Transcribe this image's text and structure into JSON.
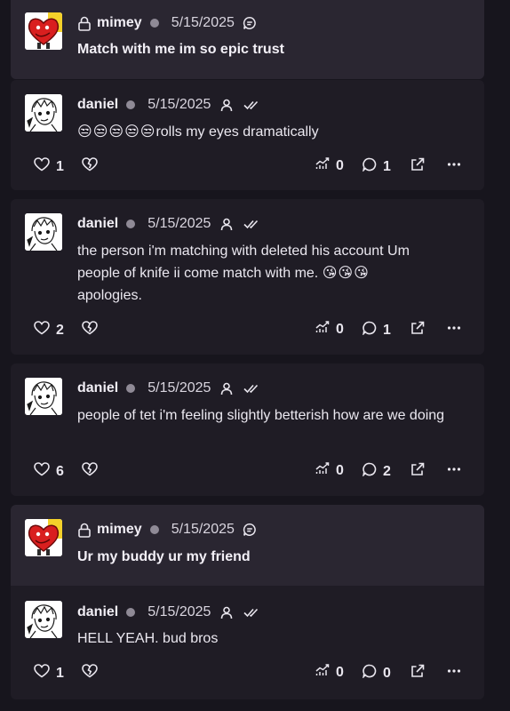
{
  "posts": [
    {
      "author": "mimey",
      "date": "5/15/2025",
      "text": "Match with me im so epic trust"
    },
    {
      "author": "daniel",
      "date": "5/15/2025",
      "emoji": [
        "😒",
        "😒",
        "😒",
        "😒",
        "😒"
      ],
      "text": "rolls my eyes dramatically",
      "likes": "1",
      "views": "0",
      "replies": "1"
    },
    {
      "author": "daniel",
      "date": "5/15/2025",
      "text_line1": "the person i'm matching with deleted his account Um",
      "text_line2": "people of knife ii come match with me.",
      "emoji": [
        "😘",
        "😘",
        "😘"
      ],
      "text_line3": "apologies.",
      "likes": "2",
      "views": "0",
      "replies": "1"
    },
    {
      "author": "daniel",
      "date": "5/15/2025",
      "text": "people of tet i'm feeling slightly betterish how are we doing",
      "likes": "6",
      "views": "0",
      "replies": "2"
    },
    {
      "author": "mimey",
      "date": "5/15/2025",
      "text": "Ur my buddy ur my friend"
    },
    {
      "author": "daniel",
      "date": "5/15/2025",
      "text": "HELL YEAH. bud bros",
      "likes": "1",
      "views": "0",
      "replies": "0"
    }
  ],
  "colors": {
    "page": "#17151d",
    "card": "#1f1c25",
    "quoted": "#2a2631",
    "status_dot": "#8f8a96"
  },
  "icons": [
    "lock-icon",
    "chat-bubble-icon",
    "person-icon",
    "double-check-icon",
    "heart-icon",
    "broken-heart-icon",
    "views-chart-icon",
    "comment-icon",
    "share-icon",
    "more-icon"
  ]
}
